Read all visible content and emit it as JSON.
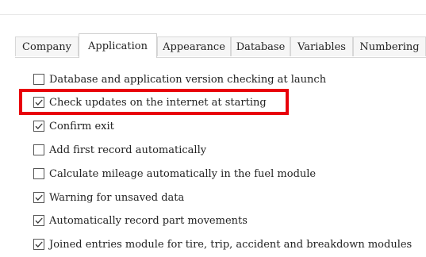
{
  "tabs": [
    {
      "label": "Company",
      "active": false
    },
    {
      "label": "Application",
      "active": true
    },
    {
      "label": "Appearance",
      "active": false
    },
    {
      "label": "Database",
      "active": false
    },
    {
      "label": "Variables",
      "active": false
    },
    {
      "label": "Numbering",
      "active": false
    }
  ],
  "options": [
    {
      "label": "Database and application version checking at launch",
      "checked": false
    },
    {
      "label": "Check updates on the internet at starting",
      "checked": true
    },
    {
      "label": "Confirm exit",
      "checked": true
    },
    {
      "label": "Add first record automatically",
      "checked": false
    },
    {
      "label": "Calculate mileage automatically in the fuel module",
      "checked": false
    },
    {
      "label": "Warning for unsaved data",
      "checked": true
    },
    {
      "label": "Automatically record part movements",
      "checked": true
    },
    {
      "label": "Joined entries module for tire, trip, accident and breakdown modules",
      "checked": true
    }
  ],
  "highlight_color": "#e8000b"
}
